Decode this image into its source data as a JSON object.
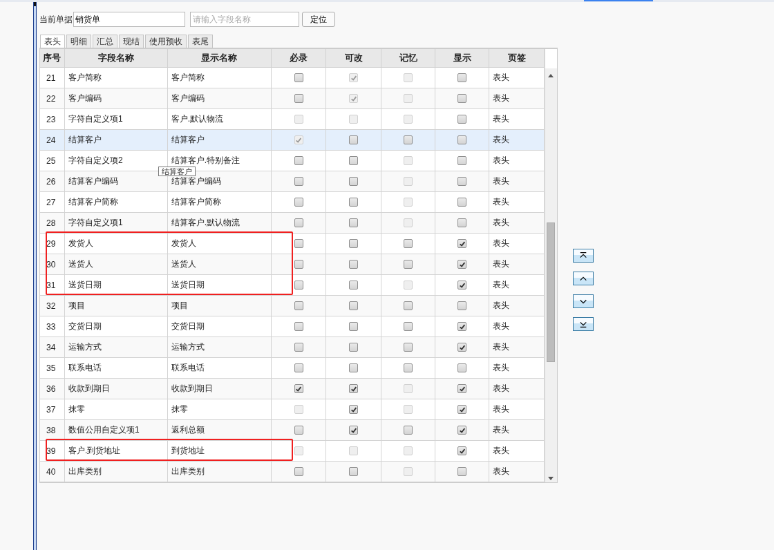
{
  "toolbar": {
    "label": "当前单据",
    "document": "销货单",
    "search": {
      "placeholder": "请输入字段名称"
    },
    "locate_button": "定位"
  },
  "tabs": [
    {
      "label": "表头",
      "selected": true
    },
    {
      "label": "明细",
      "selected": false
    },
    {
      "label": "汇总",
      "selected": false
    },
    {
      "label": "现结",
      "selected": false
    },
    {
      "label": "使用预收",
      "selected": false
    },
    {
      "label": "表尾",
      "selected": false
    }
  ],
  "table": {
    "columns": [
      "序号",
      "字段名称",
      "显示名称",
      "必录",
      "可改",
      "记忆",
      "显示",
      "页签"
    ],
    "rows": [
      {
        "no": "21",
        "field": "客户简称",
        "display": "客户简称",
        "selected": false,
        "flagged": false,
        "checks": [
          {
            "checked": false,
            "disabled": false
          },
          {
            "checked": true,
            "disabled": true
          },
          {
            "checked": false,
            "disabled": true
          },
          {
            "checked": false,
            "disabled": false
          }
        ],
        "tab": "表头"
      },
      {
        "no": "22",
        "field": "客户编码",
        "display": "客户编码",
        "selected": false,
        "flagged": false,
        "checks": [
          {
            "checked": false,
            "disabled": false
          },
          {
            "checked": true,
            "disabled": true
          },
          {
            "checked": false,
            "disabled": true
          },
          {
            "checked": false,
            "disabled": false
          }
        ],
        "tab": "表头"
      },
      {
        "no": "23",
        "field": "字符自定义项1",
        "display": "客户.默认物流",
        "selected": false,
        "flagged": false,
        "checks": [
          {
            "checked": false,
            "disabled": true
          },
          {
            "checked": false,
            "disabled": true
          },
          {
            "checked": false,
            "disabled": true
          },
          {
            "checked": false,
            "disabled": false
          }
        ],
        "tab": "表头"
      },
      {
        "no": "24",
        "field": "结算客户",
        "display": "结算客户",
        "selected": true,
        "flagged": false,
        "checks": [
          {
            "checked": true,
            "disabled": true
          },
          {
            "checked": false,
            "disabled": false
          },
          {
            "checked": false,
            "disabled": false
          },
          {
            "checked": false,
            "disabled": false
          }
        ],
        "tab": "表头"
      },
      {
        "no": "25",
        "field": "字符自定义项2",
        "display": "结算客户.特别备注",
        "selected": false,
        "flagged": false,
        "checks": [
          {
            "checked": false,
            "disabled": false
          },
          {
            "checked": false,
            "disabled": false
          },
          {
            "checked": false,
            "disabled": true
          },
          {
            "checked": false,
            "disabled": false
          }
        ],
        "tab": "表头"
      },
      {
        "no": "26",
        "field": "结算客户编码",
        "display": "结算客户编码",
        "selected": false,
        "flagged": false,
        "checks": [
          {
            "checked": false,
            "disabled": false
          },
          {
            "checked": false,
            "disabled": false
          },
          {
            "checked": false,
            "disabled": true
          },
          {
            "checked": false,
            "disabled": false
          }
        ],
        "tab": "表头"
      },
      {
        "no": "27",
        "field": "结算客户简称",
        "display": "结算客户简称",
        "selected": false,
        "flagged": false,
        "checks": [
          {
            "checked": false,
            "disabled": false
          },
          {
            "checked": false,
            "disabled": false
          },
          {
            "checked": false,
            "disabled": true
          },
          {
            "checked": false,
            "disabled": false
          }
        ],
        "tab": "表头"
      },
      {
        "no": "28",
        "field": "字符自定义项1",
        "display": "结算客户.默认物流",
        "selected": false,
        "flagged": false,
        "checks": [
          {
            "checked": false,
            "disabled": false
          },
          {
            "checked": false,
            "disabled": false
          },
          {
            "checked": false,
            "disabled": true
          },
          {
            "checked": false,
            "disabled": false
          }
        ],
        "tab": "表头"
      },
      {
        "no": "29",
        "field": "发货人",
        "display": "发货人",
        "selected": false,
        "flagged": true,
        "checks": [
          {
            "checked": false,
            "disabled": false
          },
          {
            "checked": false,
            "disabled": false
          },
          {
            "checked": false,
            "disabled": false
          },
          {
            "checked": true,
            "disabled": false
          }
        ],
        "tab": "表头"
      },
      {
        "no": "30",
        "field": "送货人",
        "display": "送货人",
        "selected": false,
        "flagged": true,
        "checks": [
          {
            "checked": false,
            "disabled": false
          },
          {
            "checked": false,
            "disabled": false
          },
          {
            "checked": false,
            "disabled": false
          },
          {
            "checked": true,
            "disabled": false
          }
        ],
        "tab": "表头"
      },
      {
        "no": "31",
        "field": "送货日期",
        "display": "送货日期",
        "selected": false,
        "flagged": true,
        "checks": [
          {
            "checked": false,
            "disabled": false
          },
          {
            "checked": false,
            "disabled": false
          },
          {
            "checked": false,
            "disabled": true
          },
          {
            "checked": true,
            "disabled": false
          }
        ],
        "tab": "表头"
      },
      {
        "no": "32",
        "field": "项目",
        "display": "项目",
        "selected": false,
        "flagged": false,
        "checks": [
          {
            "checked": false,
            "disabled": false
          },
          {
            "checked": false,
            "disabled": false
          },
          {
            "checked": false,
            "disabled": false
          },
          {
            "checked": false,
            "disabled": false
          }
        ],
        "tab": "表头"
      },
      {
        "no": "33",
        "field": "交货日期",
        "display": "交货日期",
        "selected": false,
        "flagged": false,
        "checks": [
          {
            "checked": false,
            "disabled": false
          },
          {
            "checked": false,
            "disabled": false
          },
          {
            "checked": false,
            "disabled": false
          },
          {
            "checked": true,
            "disabled": false
          }
        ],
        "tab": "表头"
      },
      {
        "no": "34",
        "field": "运输方式",
        "display": "运输方式",
        "selected": false,
        "flagged": false,
        "checks": [
          {
            "checked": false,
            "disabled": false
          },
          {
            "checked": false,
            "disabled": false
          },
          {
            "checked": false,
            "disabled": false
          },
          {
            "checked": true,
            "disabled": false
          }
        ],
        "tab": "表头"
      },
      {
        "no": "35",
        "field": "联系电话",
        "display": "联系电话",
        "selected": false,
        "flagged": false,
        "checks": [
          {
            "checked": false,
            "disabled": false
          },
          {
            "checked": false,
            "disabled": false
          },
          {
            "checked": false,
            "disabled": false
          },
          {
            "checked": false,
            "disabled": false
          }
        ],
        "tab": "表头"
      },
      {
        "no": "36",
        "field": "收款到期日",
        "display": "收款到期日",
        "selected": false,
        "flagged": false,
        "checks": [
          {
            "checked": true,
            "disabled": false
          },
          {
            "checked": true,
            "disabled": false
          },
          {
            "checked": false,
            "disabled": true
          },
          {
            "checked": true,
            "disabled": false
          }
        ],
        "tab": "表头"
      },
      {
        "no": "37",
        "field": "抹零",
        "display": "抹零",
        "selected": false,
        "flagged": false,
        "checks": [
          {
            "checked": false,
            "disabled": true
          },
          {
            "checked": true,
            "disabled": false
          },
          {
            "checked": false,
            "disabled": true
          },
          {
            "checked": true,
            "disabled": false
          }
        ],
        "tab": "表头"
      },
      {
        "no": "38",
        "field": "数值公用自定义项1",
        "display": "返利总额",
        "selected": false,
        "flagged": false,
        "checks": [
          {
            "checked": false,
            "disabled": false
          },
          {
            "checked": true,
            "disabled": false
          },
          {
            "checked": false,
            "disabled": false
          },
          {
            "checked": true,
            "disabled": false
          }
        ],
        "tab": "表头"
      },
      {
        "no": "39",
        "field": "客户.到货地址",
        "display": "到货地址",
        "selected": false,
        "flagged": true,
        "checks": [
          {
            "checked": false,
            "disabled": true
          },
          {
            "checked": false,
            "disabled": true
          },
          {
            "checked": false,
            "disabled": true
          },
          {
            "checked": true,
            "disabled": false
          }
        ],
        "tab": "表头"
      },
      {
        "no": "40",
        "field": "出库类别",
        "display": "出库类别",
        "selected": false,
        "flagged": false,
        "checks": [
          {
            "checked": false,
            "disabled": false
          },
          {
            "checked": false,
            "disabled": false
          },
          {
            "checked": false,
            "disabled": true
          },
          {
            "checked": false,
            "disabled": false
          }
        ],
        "tab": "表头"
      }
    ]
  },
  "tooltip": "结算客户",
  "move_buttons": [
    {
      "kind": "top"
    },
    {
      "kind": "up"
    },
    {
      "kind": "down"
    },
    {
      "kind": "bottom"
    }
  ]
}
